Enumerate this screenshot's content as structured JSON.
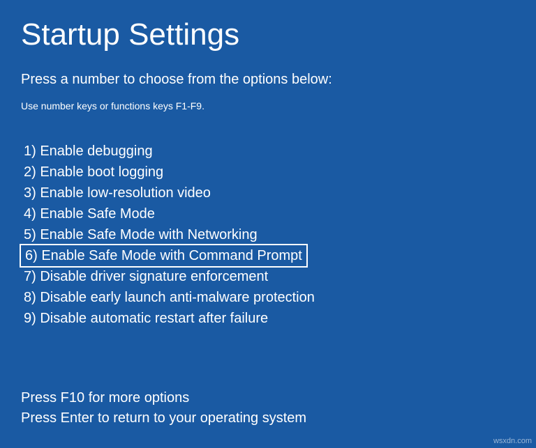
{
  "title": "Startup Settings",
  "subtitle": "Press a number to choose from the options below:",
  "hint": "Use number keys or functions keys F1-F9.",
  "options": [
    {
      "label": "1) Enable debugging",
      "highlighted": false
    },
    {
      "label": "2) Enable boot logging",
      "highlighted": false
    },
    {
      "label": "3) Enable low-resolution video",
      "highlighted": false
    },
    {
      "label": "4) Enable Safe Mode",
      "highlighted": false
    },
    {
      "label": "5) Enable Safe Mode with Networking",
      "highlighted": false
    },
    {
      "label": "6) Enable Safe Mode with Command Prompt",
      "highlighted": true
    },
    {
      "label": "7) Disable driver signature enforcement",
      "highlighted": false
    },
    {
      "label": "8) Disable early launch anti-malware protection",
      "highlighted": false
    },
    {
      "label": "9) Disable automatic restart after failure",
      "highlighted": false
    }
  ],
  "footer": {
    "line1": "Press F10 for more options",
    "line2": "Press Enter to return to your operating system"
  },
  "watermark": "wsxdn.com"
}
